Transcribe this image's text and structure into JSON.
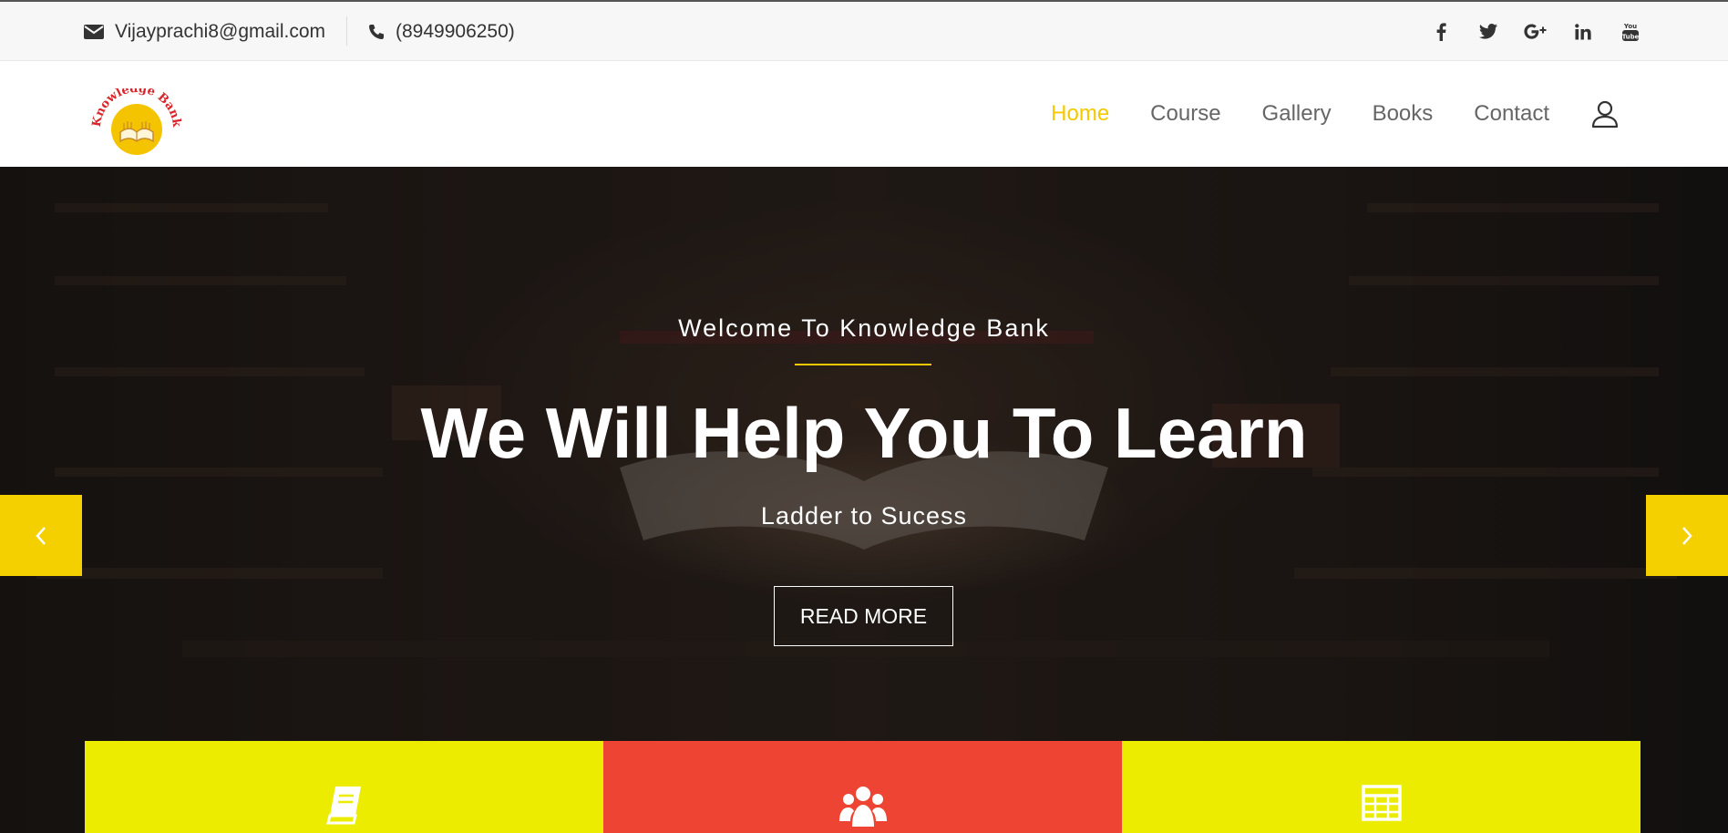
{
  "topbar": {
    "email": "Vijayprachi8@gmail.com",
    "phone": "(8949906250)",
    "email_icon": "envelope-icon",
    "phone_icon": "phone-icon",
    "social": [
      {
        "name": "facebook-icon",
        "glyph": "f"
      },
      {
        "name": "twitter-icon",
        "glyph": "t"
      },
      {
        "name": "google-plus-icon",
        "glyph": "G+"
      },
      {
        "name": "linkedin-icon",
        "glyph": "in"
      },
      {
        "name": "youtube-icon",
        "glyph": "You"
      }
    ]
  },
  "header": {
    "logo_text": "Knowledge Bank",
    "nav": [
      {
        "label": "Home",
        "active": true
      },
      {
        "label": "Course",
        "active": false
      },
      {
        "label": "Gallery",
        "active": false
      },
      {
        "label": "Books",
        "active": false
      },
      {
        "label": "Contact",
        "active": false
      }
    ],
    "user_icon": "user-icon"
  },
  "hero": {
    "kicker": "Welcome To Knowledge Bank",
    "title": "We Will Help You To Learn",
    "subtitle": "Ladder to Sucess",
    "button": "READ MORE",
    "prev_icon": "chevron-left-icon",
    "next_icon": "chevron-right-icon"
  },
  "features": [
    {
      "icon": "book-icon",
      "color": "#ecec00"
    },
    {
      "icon": "users-icon",
      "color": "#ee4433"
    },
    {
      "icon": "table-icon",
      "color": "#ecec00"
    }
  ],
  "colors": {
    "accent": "#f5c800",
    "arrow_bg": "#f5d000",
    "nav_text": "#666666"
  }
}
